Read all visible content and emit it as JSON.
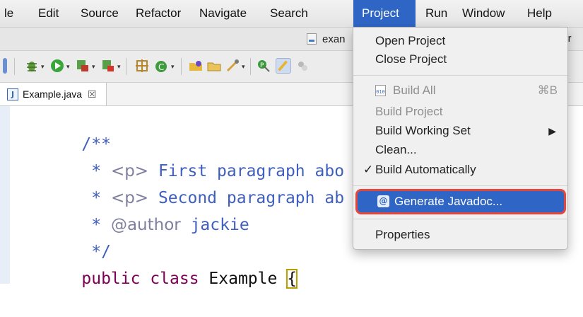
{
  "menubar": {
    "items": [
      "le",
      "Edit",
      "Source",
      "Refactor",
      "Navigate",
      "Search",
      "Project",
      "Run",
      "Window",
      "Help"
    ],
    "active": "Project"
  },
  "titlebar": {
    "file_tab": "exan",
    "path_tail": "/sr"
  },
  "editor_tab": {
    "label": "Example.java",
    "icon": "J",
    "close_glyph": "☒"
  },
  "code": {
    "line1": "/**",
    "line2_star": " * ",
    "line2_tag": "<p>",
    "line2_text": " First paragraph abo",
    "line3_star": " * ",
    "line3_tag": "<p>",
    "line3_text": " Second paragraph ab",
    "line4_star": " * ",
    "line4_tag": "@author",
    "line4_text": " jackie",
    "line5": " */",
    "line6_kw": "public class",
    "line6_name": " Example ",
    "line6_brace": "{"
  },
  "project_menu": {
    "open_project": "Open Project",
    "close_project": "Close Project",
    "build_all": "Build All",
    "build_all_shortcut": "⌘B",
    "build_project": "Build Project",
    "build_working_set": "Build Working Set",
    "clean": "Clean...",
    "build_automatically": "Build Automatically",
    "build_automatically_checked": "✓",
    "generate_javadoc": "Generate Javadoc...",
    "properties": "Properties",
    "submenu_arrow": "▶"
  },
  "icons": {
    "accent": "#2f66c6",
    "highlight_ring": "#e5453b"
  }
}
